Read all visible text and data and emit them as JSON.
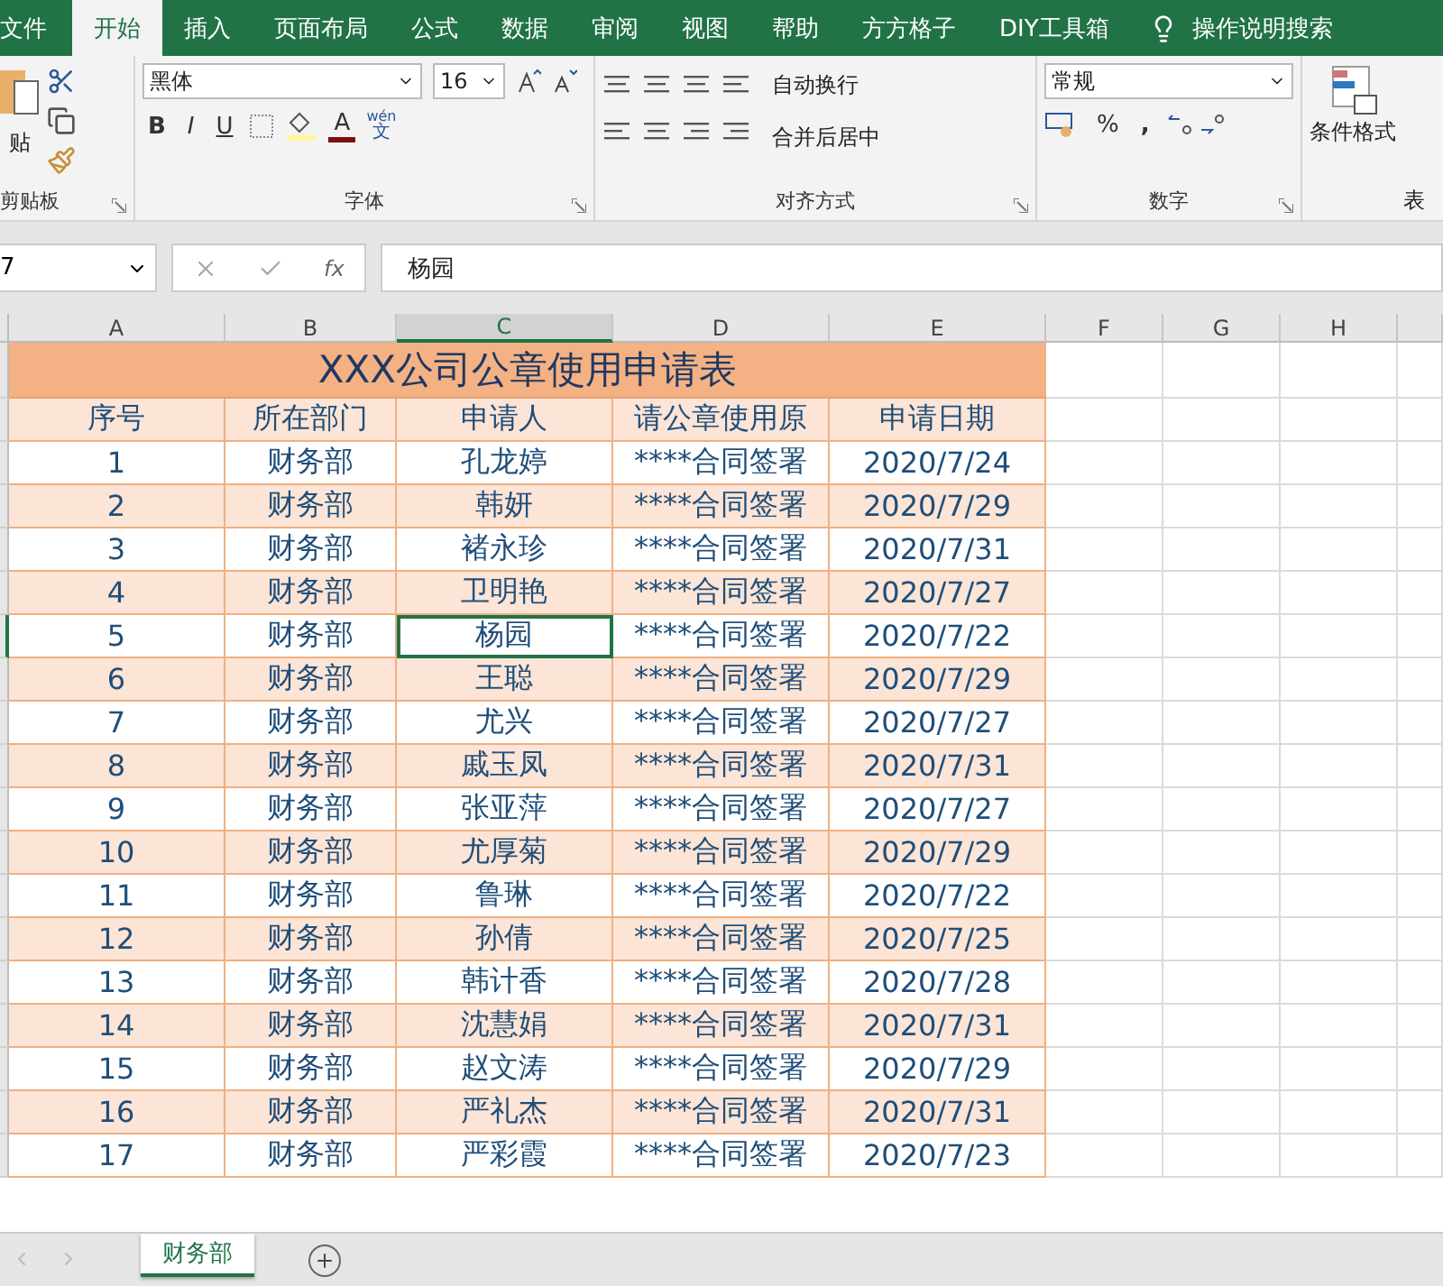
{
  "menu_tabs": [
    {
      "label": "文件",
      "selected": false
    },
    {
      "label": "开始",
      "selected": true
    },
    {
      "label": "插入",
      "selected": false
    },
    {
      "label": "页面布局",
      "selected": false
    },
    {
      "label": "公式",
      "selected": false
    },
    {
      "label": "数据",
      "selected": false
    },
    {
      "label": "审阅",
      "selected": false
    },
    {
      "label": "视图",
      "selected": false
    },
    {
      "label": "帮助",
      "selected": false
    },
    {
      "label": "方方格子",
      "selected": false
    },
    {
      "label": "DIY工具箱",
      "selected": false
    }
  ],
  "tell_me": "操作说明搜索",
  "ribbon": {
    "clipboard": {
      "paste": "贴",
      "label": "剪贴板"
    },
    "font": {
      "name": "黑体",
      "size": "16",
      "phonetic_top": "wén",
      "phonetic_bottom": "文",
      "label": "字体",
      "bold": "B",
      "italic": "I",
      "underline": "U",
      "font_color_letter": "A"
    },
    "alignment": {
      "wrap": "自动换行",
      "merge": "合并后居中",
      "label": "对齐方式"
    },
    "number": {
      "format": "常规",
      "percent": "%",
      "comma": ",",
      "label": "数字"
    },
    "styles": {
      "conditional": "条件格式",
      "table": "表"
    }
  },
  "formula_bar": {
    "name_box": "7",
    "fx": "fx",
    "content": "杨园"
  },
  "columns": [
    {
      "label": "A",
      "selected": false
    },
    {
      "label": "B",
      "selected": false
    },
    {
      "label": "C",
      "selected": true
    },
    {
      "label": "D",
      "selected": false
    },
    {
      "label": "E",
      "selected": false
    },
    {
      "label": "F",
      "selected": false
    },
    {
      "label": "G",
      "selected": false
    },
    {
      "label": "H",
      "selected": false
    }
  ],
  "sheet": {
    "title": "XXX公司公章使用申请表",
    "headers": [
      "序号",
      "所在部门",
      "申请人",
      "请公章使用原",
      "申请日期"
    ],
    "rows": [
      {
        "cells": [
          "1",
          "财务部",
          "孔龙婷",
          "****合同签署",
          "2020/7/24"
        ],
        "selected": false
      },
      {
        "cells": [
          "2",
          "财务部",
          "韩妍",
          "****合同签署",
          "2020/7/29"
        ],
        "selected": false
      },
      {
        "cells": [
          "3",
          "财务部",
          "褚永珍",
          "****合同签署",
          "2020/7/31"
        ],
        "selected": false
      },
      {
        "cells": [
          "4",
          "财务部",
          "卫明艳",
          "****合同签署",
          "2020/7/27"
        ],
        "selected": false
      },
      {
        "cells": [
          "5",
          "财务部",
          "杨园",
          "****合同签署",
          "2020/7/22"
        ],
        "selected": true
      },
      {
        "cells": [
          "6",
          "财务部",
          "王聪",
          "****合同签署",
          "2020/7/29"
        ],
        "selected": false
      },
      {
        "cells": [
          "7",
          "财务部",
          "尤兴",
          "****合同签署",
          "2020/7/27"
        ],
        "selected": false
      },
      {
        "cells": [
          "8",
          "财务部",
          "戚玉凤",
          "****合同签署",
          "2020/7/31"
        ],
        "selected": false
      },
      {
        "cells": [
          "9",
          "财务部",
          "张亚萍",
          "****合同签署",
          "2020/7/27"
        ],
        "selected": false
      },
      {
        "cells": [
          "10",
          "财务部",
          "尤厚菊",
          "****合同签署",
          "2020/7/29"
        ],
        "selected": false
      },
      {
        "cells": [
          "11",
          "财务部",
          "鲁琳",
          "****合同签署",
          "2020/7/22"
        ],
        "selected": false
      },
      {
        "cells": [
          "12",
          "财务部",
          "孙倩",
          "****合同签署",
          "2020/7/25"
        ],
        "selected": false
      },
      {
        "cells": [
          "13",
          "财务部",
          "韩计香",
          "****合同签署",
          "2020/7/28"
        ],
        "selected": false
      },
      {
        "cells": [
          "14",
          "财务部",
          "沈慧娟",
          "****合同签署",
          "2020/7/31"
        ],
        "selected": false
      },
      {
        "cells": [
          "15",
          "财务部",
          "赵文涛",
          "****合同签署",
          "2020/7/29"
        ],
        "selected": false
      },
      {
        "cells": [
          "16",
          "财务部",
          "严礼杰",
          "****合同签署",
          "2020/7/31"
        ],
        "selected": false
      },
      {
        "cells": [
          "17",
          "财务部",
          "严彩霞",
          "****合同签署",
          "2020/7/23"
        ],
        "selected": false
      }
    ]
  },
  "sheet_tabs": [
    {
      "label": "财务部",
      "selected": true
    }
  ]
}
